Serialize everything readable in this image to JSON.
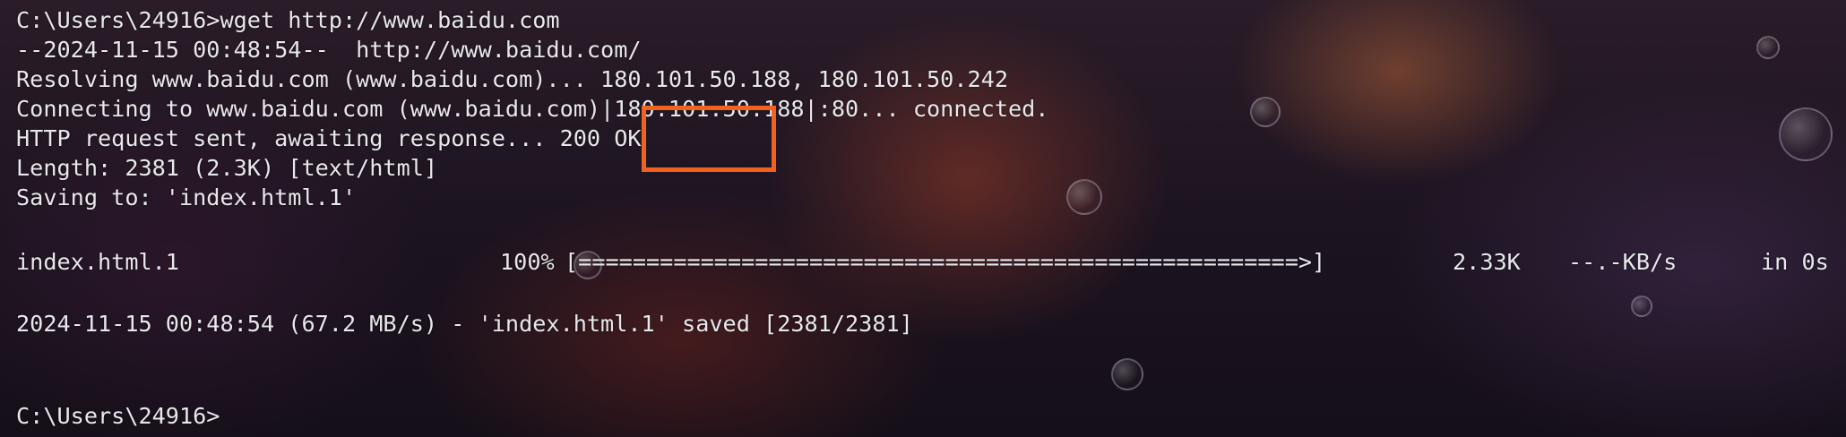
{
  "terminal": {
    "lines": [
      "C:\\Users\\24916>wget http://www.baidu.com",
      "--2024-11-15 00:48:54--  http://www.baidu.com/",
      "Resolving www.baidu.com (www.baidu.com)... 180.101.50.188, 180.101.50.242",
      "Connecting to www.baidu.com (www.baidu.com)|180.101.50.188|:80... connected.",
      "HTTP request sent, awaiting response... 200 OK",
      "Length: 2381 (2.3K) [text/html]",
      "Saving to: 'index.html.1'"
    ],
    "progress": {
      "filename": "index.html.1",
      "percent": "100%",
      "bar": "[=====================================================>]",
      "size": "2.33K",
      "rate": "--.-KB/s",
      "eta": "in 0s"
    },
    "summary": "2024-11-15 00:48:54 (67.2 MB/s) - 'index.html.1' saved [2381/2381]",
    "prompt": "C:\\Users\\24916>"
  },
  "annotation": {
    "highlight_color": "#f0621e"
  }
}
